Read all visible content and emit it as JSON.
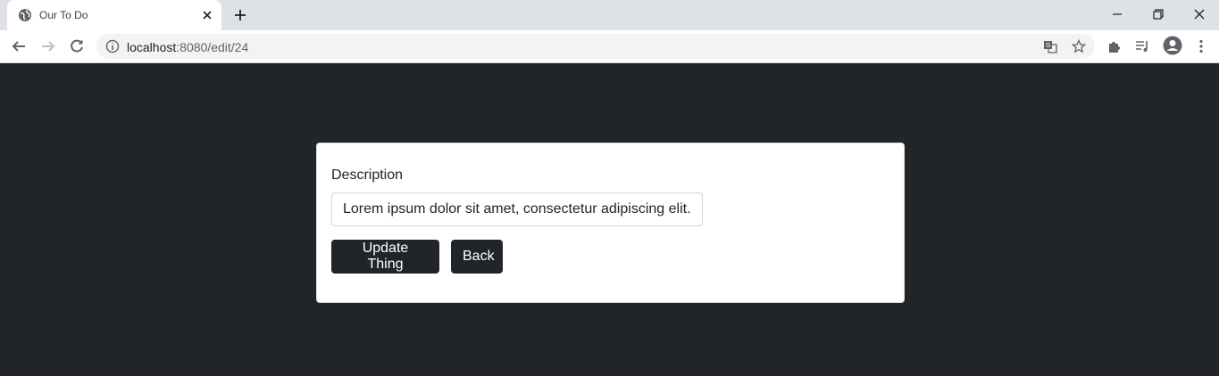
{
  "browser": {
    "tab_title": "Our To Do",
    "url_host": "localhost",
    "url_rest": ":8080/edit/24"
  },
  "form": {
    "label": "Description",
    "input_value": "Lorem ipsum dolor sit amet, consectetur adipiscing elit.",
    "update_label": "Update Thing",
    "back_label": "Back"
  },
  "colors": {
    "page_bg": "#212529",
    "button_bg": "#212529",
    "card_bg": "#ffffff"
  },
  "icons": [
    "globe-icon",
    "close-icon",
    "plus-icon",
    "minimize-icon",
    "restore-icon",
    "window-close-icon",
    "back-arrow-icon",
    "forward-arrow-icon",
    "reload-icon",
    "info-icon",
    "translate-icon",
    "star-icon",
    "extensions-icon",
    "media-icon",
    "profile-icon",
    "menu-icon"
  ]
}
